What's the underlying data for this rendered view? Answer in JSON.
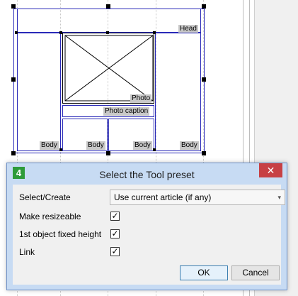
{
  "layout_labels": {
    "head": "Head",
    "photo": "Photo",
    "photo_caption": "Photo caption",
    "body": "Body"
  },
  "dialog": {
    "app_icon": "4",
    "title": "Select the Tool preset",
    "close_glyph": "✕",
    "fields": {
      "select_create_label": "Select/Create",
      "select_create_value": "Use current article (if any)",
      "make_resizeable_label": "Make resizeable",
      "first_object_label": "1st object fixed height",
      "link_label": "Link",
      "checkmark": "✓"
    },
    "buttons": {
      "ok": "OK",
      "cancel": "Cancel"
    },
    "select_arrow": "▾"
  },
  "colors": {
    "frame_blue": "#2a2ab8",
    "dialog_border": "#6b8fc7",
    "close_red": "#c74044"
  }
}
